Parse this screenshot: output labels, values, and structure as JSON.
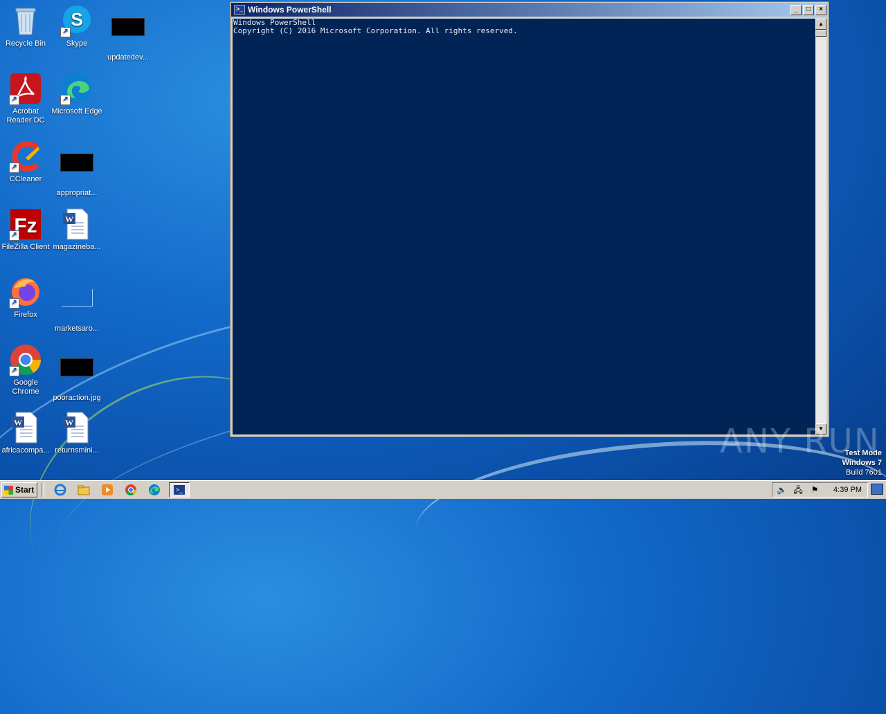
{
  "desktop": {
    "icons": [
      {
        "label": "Recycle Bin"
      },
      {
        "label": "Skype"
      },
      {
        "label": "updatedev..."
      },
      {
        "label": "Acrobat Reader DC"
      },
      {
        "label": "Microsoft Edge"
      },
      {
        "label": "CCleaner"
      },
      {
        "label": "appropriat..."
      },
      {
        "label": "FileZilla Client"
      },
      {
        "label": "magazineba..."
      },
      {
        "label": "Firefox"
      },
      {
        "label": "marketsaro..."
      },
      {
        "label": "Google Chrome"
      },
      {
        "label": "pooraction.jpg"
      },
      {
        "label": "africacompa..."
      },
      {
        "label": "returnsmini..."
      }
    ]
  },
  "powershell": {
    "title": "Windows PowerShell",
    "line1": "Windows PowerShell",
    "line2": "Copyright (C) 2016 Microsoft Corporation. All rights reserved.",
    "bg_color": "#012456"
  },
  "watermark": {
    "brand": "ANY RUN",
    "mode": "Test Mode",
    "os": "Windows 7",
    "build": "Build 7601"
  },
  "taskbar": {
    "start_label": "Start",
    "clock": "4:39 PM"
  }
}
